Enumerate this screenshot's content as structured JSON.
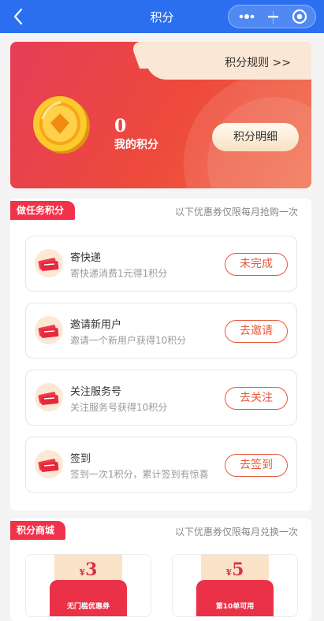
{
  "nav": {
    "title": "积分",
    "back_icon": "chevron-left-icon",
    "more_icon": "more-dots-icon",
    "minimize_icon": "minimize-icon",
    "close_icon": "target-circle-icon",
    "bg_color": "#2b6ff0"
  },
  "points_card": {
    "rules_link": "积分规则 >>",
    "points_value": "0",
    "points_label": "我的积分",
    "detail_button": "积分明细",
    "coin_icon": "gold-coin-icon"
  },
  "tasks_section": {
    "tag": "做任务积分",
    "note": "以下优惠券仅限每月抢购一次",
    "items": [
      {
        "title": "寄快递",
        "subtitle": "寄快递消费1元得1积分",
        "button": "未完成",
        "icon": "ticket-icon"
      },
      {
        "title": "邀请新用户",
        "subtitle": "邀请一个新用户获得10积分",
        "button": "去邀请",
        "icon": "ticket-icon"
      },
      {
        "title": "关注服务号",
        "subtitle": "关注服务号获得10积分",
        "button": "去关注",
        "icon": "ticket-icon"
      },
      {
        "title": "签到",
        "subtitle": "签到一次1积分，累计签到有惊喜",
        "button": "去签到",
        "icon": "ticket-icon"
      }
    ]
  },
  "shop_section": {
    "tag": "积分商城",
    "note": "以下优惠券仅限每月兑换一次",
    "coupons": [
      {
        "currency": "¥",
        "amount": "3",
        "label": "无门槛优惠券"
      },
      {
        "currency": "¥",
        "amount": "5",
        "label": "第10单可用"
      }
    ]
  },
  "colors": {
    "accent_red": "#f2324a",
    "task_button": "#e9583a",
    "card_gradient_start": "#e63d57",
    "card_gradient_end": "#f06a45"
  }
}
